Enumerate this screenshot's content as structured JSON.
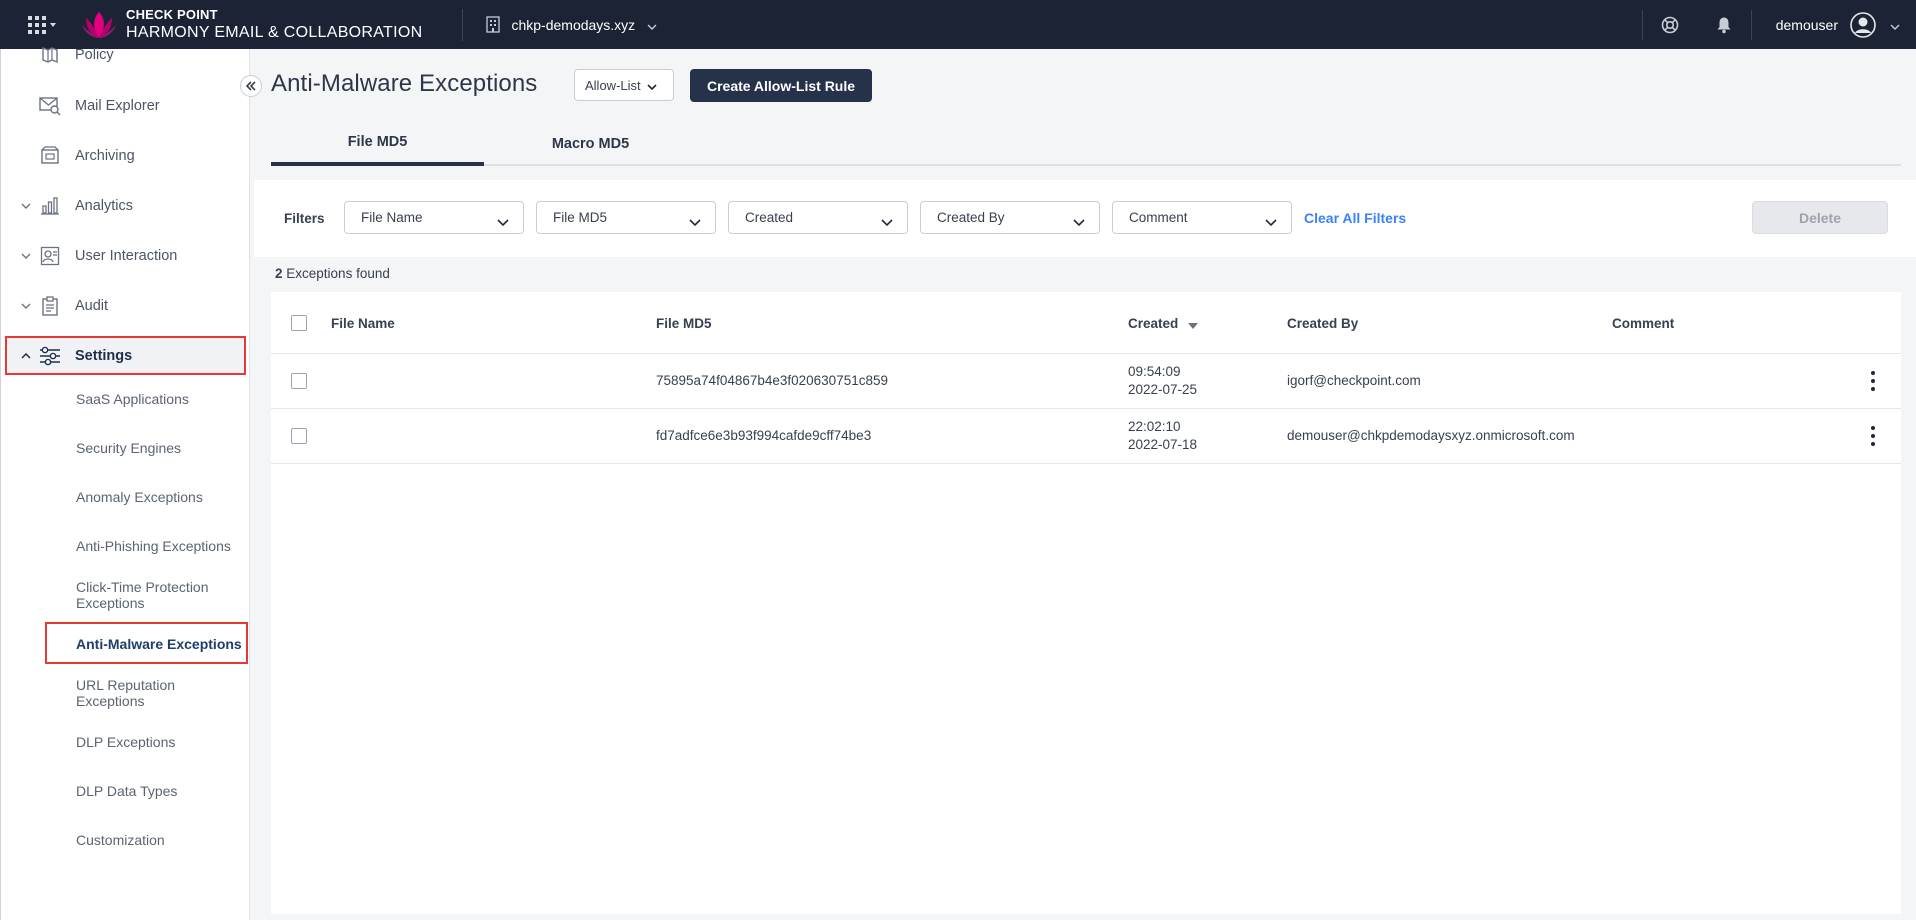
{
  "header": {
    "brand_line1": "CHECK POINT",
    "brand_line2": "HARMONY EMAIL & COLLABORATION",
    "tenant": "chkp-demodays.xyz",
    "username": "demouser"
  },
  "sidebar": {
    "items": [
      {
        "label": "Policy"
      },
      {
        "label": "Mail Explorer"
      },
      {
        "label": "Archiving"
      },
      {
        "label": "Analytics"
      },
      {
        "label": "User Interaction"
      },
      {
        "label": "Audit"
      },
      {
        "label": "Settings"
      }
    ],
    "settings_sub": [
      {
        "label": "SaaS Applications"
      },
      {
        "label": "Security Engines"
      },
      {
        "label": "Anomaly Exceptions"
      },
      {
        "label": "Anti-Phishing Exceptions"
      },
      {
        "label": "Click-Time Protection Exceptions"
      },
      {
        "label": "Anti-Malware Exceptions"
      },
      {
        "label": "URL Reputation Exceptions"
      },
      {
        "label": "DLP Exceptions"
      },
      {
        "label": "DLP Data Types"
      },
      {
        "label": "Customization"
      }
    ]
  },
  "main": {
    "title": "Anti-Malware Exceptions",
    "list_select": "Allow-List",
    "create_button": "Create Allow-List Rule",
    "tabs": [
      {
        "label": "File MD5",
        "active": true
      },
      {
        "label": "Macro MD5",
        "active": false
      }
    ],
    "filters": {
      "label": "Filters",
      "selects": [
        "File Name",
        "File MD5",
        "Created",
        "Created By",
        "Comment"
      ],
      "clear": "Clear All Filters",
      "delete": "Delete"
    },
    "count_number": "2",
    "count_text": "Exceptions found",
    "table": {
      "columns": [
        "File Name",
        "File MD5",
        "Created",
        "Created By",
        "Comment"
      ],
      "rows": [
        {
          "file_name": "",
          "file_md5": "75895a74f04867b4e3f020630751c859",
          "created_time": "09:54:09",
          "created_date": "2022-07-25",
          "created_by": "igorf@checkpoint.com",
          "comment": ""
        },
        {
          "file_name": "",
          "file_md5": "fd7adfce6e3b93f994cafde9cff74be3",
          "created_time": "22:02:10",
          "created_date": "2022-07-18",
          "created_by": "demouser@chkpdemodaysxyz.onmicrosoft.com",
          "comment": ""
        }
      ]
    }
  },
  "colors": {
    "topbar": "#1b2334",
    "primary_button": "#25324a",
    "link": "#3b82f6",
    "highlight_box": "#e53935"
  }
}
